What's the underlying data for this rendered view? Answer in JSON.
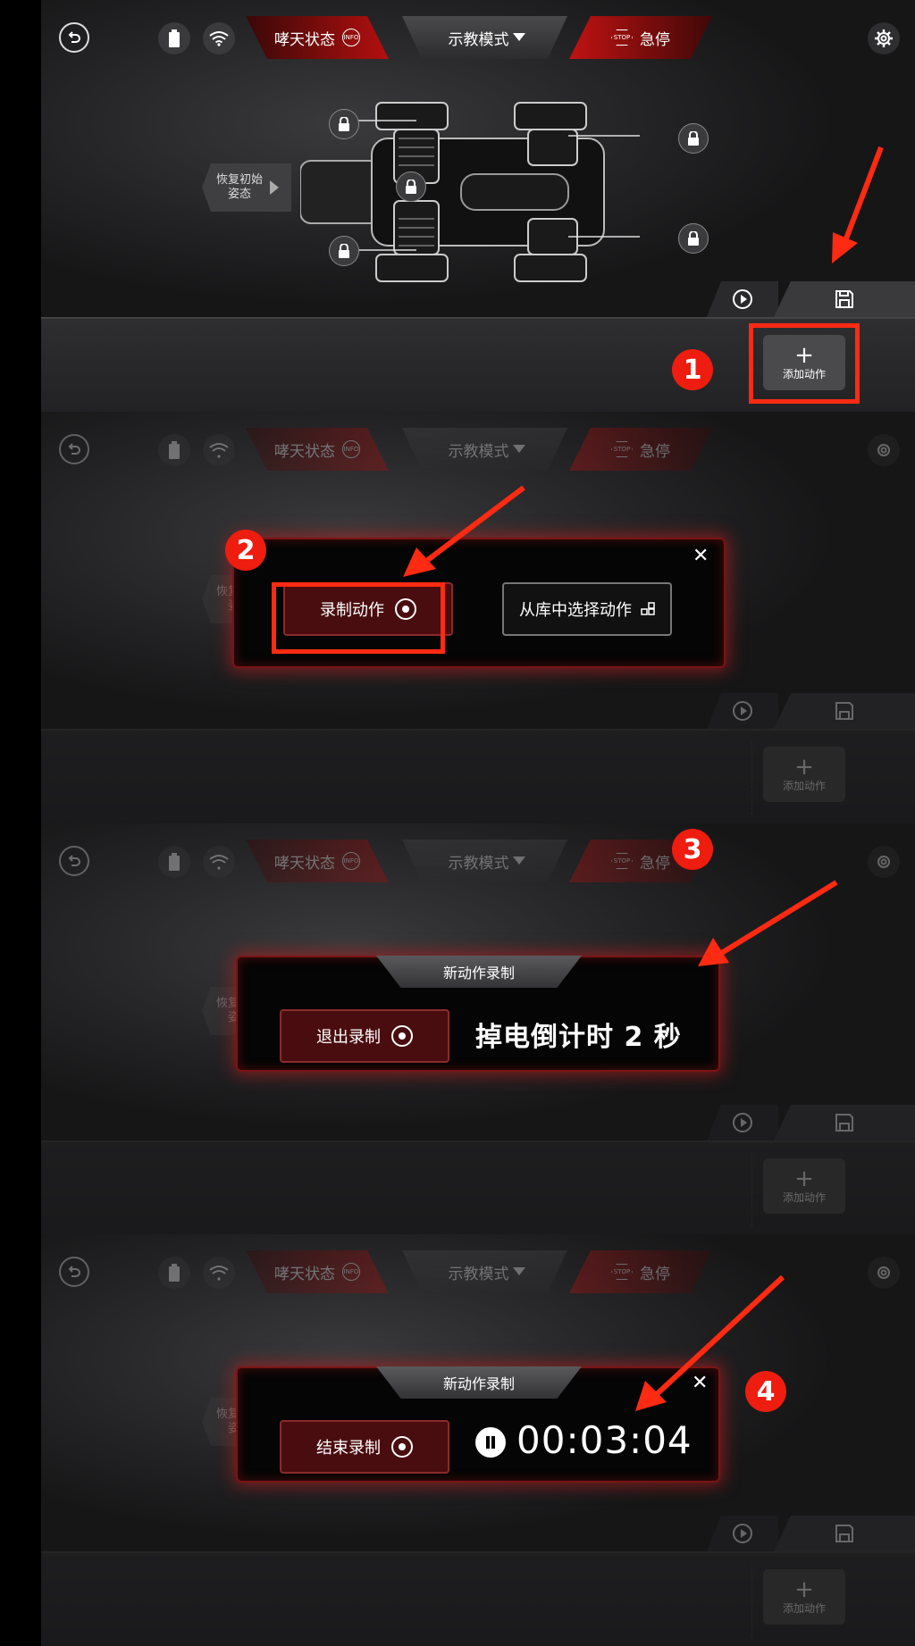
{
  "app": {
    "status_tab": "哮天状态",
    "mode_tab": "示教模式",
    "stop_tab": "急停",
    "info_badge": "INFO",
    "stop_badge": "STOP",
    "restore_label": "恢复初始姿态",
    "add_action_label": "添加动作"
  },
  "steps": {
    "one": "1",
    "two": "2",
    "three": "3",
    "four": "4"
  },
  "dialog_choose": {
    "record_button": "录制动作",
    "library_button": "从库中选择动作"
  },
  "dialog_countdown": {
    "title": "新动作录制",
    "exit_button": "退出录制",
    "countdown_text": "掉电倒计时 2 秒"
  },
  "dialog_recording": {
    "title": "新动作录制",
    "end_button": "结束录制",
    "timer": "00:03:04"
  },
  "colors": {
    "accent_red": "#ee1d0f",
    "status_red": "#b40f0f",
    "background": "#252527"
  }
}
